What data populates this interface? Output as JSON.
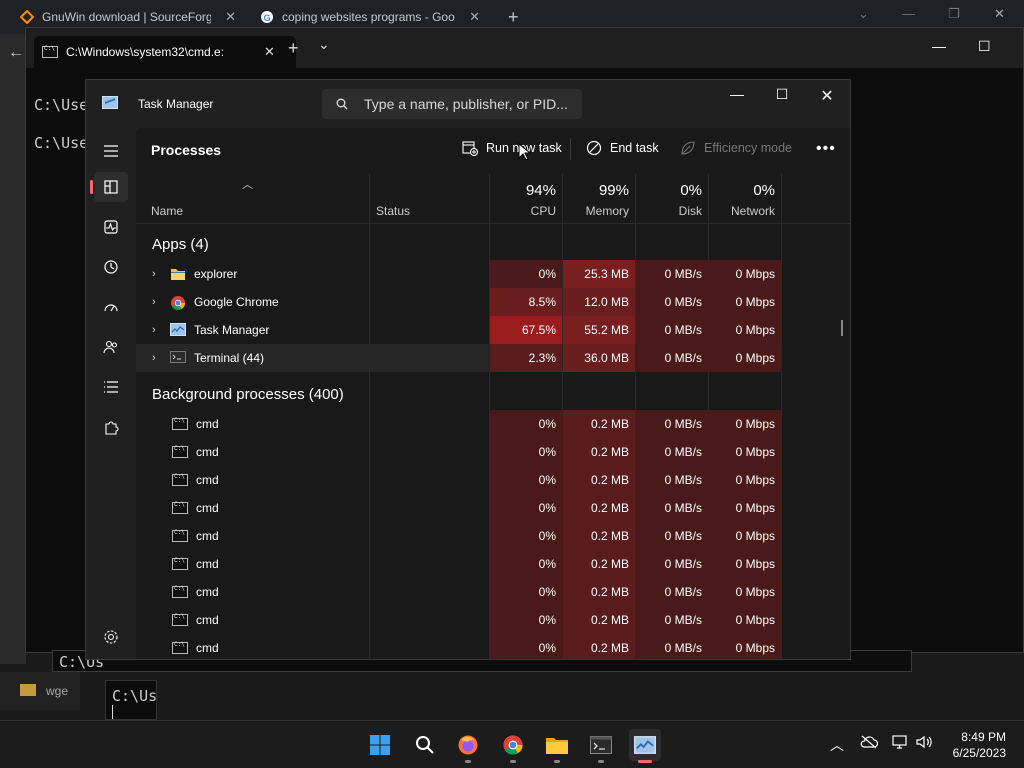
{
  "browser": {
    "tabs": [
      {
        "title": "GnuWin download | SourceForge",
        "close": "✕"
      },
      {
        "title": "coping websites programs - Goo",
        "close": "✕"
      }
    ],
    "new_tab": "+"
  },
  "terminal": {
    "tab_title": "C:\\Windows\\system32\\cmd.e:",
    "close": "✕",
    "new_tab": "+",
    "dropdown": "⌄",
    "prompt_lines": [
      "C:\\Use",
      "C:\\Use"
    ],
    "behind_lines": [
      "C:\\Us",
      "C:\\Us",
      "wge"
    ]
  },
  "task_manager": {
    "title": "Task Manager",
    "search_placeholder": "Type a name, publisher, or PID...",
    "page_title": "Processes",
    "toolbar": {
      "run_new_task": "Run new task",
      "end_task": "End task",
      "efficiency_mode": "Efficiency mode",
      "more": "•••"
    },
    "columns": {
      "name": "Name",
      "status": "Status",
      "cpu_pct": "94%",
      "cpu": "CPU",
      "mem_pct": "99%",
      "mem": "Memory",
      "disk_pct": "0%",
      "disk": "Disk",
      "net_pct": "0%",
      "net": "Network"
    },
    "groups": {
      "apps": "Apps (4)",
      "background": "Background processes (400)"
    },
    "apps": [
      {
        "name": "explorer",
        "icon": "folder-icon",
        "cpu": "0%",
        "mem": "25.3 MB",
        "disk": "0 MB/s",
        "net": "0 Mbps"
      },
      {
        "name": "Google Chrome",
        "icon": "chrome-icon",
        "cpu": "8.5%",
        "mem": "12.0 MB",
        "disk": "0 MB/s",
        "net": "0 Mbps"
      },
      {
        "name": "Task Manager",
        "icon": "task-manager-icon",
        "cpu": "67.5%",
        "mem": "55.2 MB",
        "disk": "0 MB/s",
        "net": "0 Mbps"
      },
      {
        "name": "Terminal (44)",
        "icon": "terminal-icon",
        "cpu": "2.3%",
        "mem": "36.0 MB",
        "disk": "0 MB/s",
        "net": "0 Mbps"
      }
    ],
    "background": [
      {
        "name": "cmd",
        "cpu": "0%",
        "mem": "0.2 MB",
        "disk": "0 MB/s",
        "net": "0 Mbps"
      },
      {
        "name": "cmd",
        "cpu": "0%",
        "mem": "0.2 MB",
        "disk": "0 MB/s",
        "net": "0 Mbps"
      },
      {
        "name": "cmd",
        "cpu": "0%",
        "mem": "0.2 MB",
        "disk": "0 MB/s",
        "net": "0 Mbps"
      },
      {
        "name": "cmd",
        "cpu": "0%",
        "mem": "0.2 MB",
        "disk": "0 MB/s",
        "net": "0 Mbps"
      },
      {
        "name": "cmd",
        "cpu": "0%",
        "mem": "0.2 MB",
        "disk": "0 MB/s",
        "net": "0 Mbps"
      },
      {
        "name": "cmd",
        "cpu": "0%",
        "mem": "0.2 MB",
        "disk": "0 MB/s",
        "net": "0 Mbps"
      },
      {
        "name": "cmd",
        "cpu": "0%",
        "mem": "0.2 MB",
        "disk": "0 MB/s",
        "net": "0 Mbps"
      },
      {
        "name": "cmd",
        "cpu": "0%",
        "mem": "0.2 MB",
        "disk": "0 MB/s",
        "net": "0 Mbps"
      },
      {
        "name": "cmd",
        "cpu": "0%",
        "mem": "0.2 MB",
        "disk": "0 MB/s",
        "net": "0 Mbps"
      }
    ],
    "colors": {
      "heat_low": "#4a1a1a",
      "heat_mid": "#6b1e1e",
      "heat_high": "#9b1c1c",
      "accent": "#ff6b6b"
    }
  },
  "taskbar": {
    "time": "8:49 PM",
    "date": "6/25/2023",
    "icons": [
      "windows-start-icon",
      "search-icon",
      "firefox-icon",
      "chrome-icon",
      "file-explorer-icon",
      "terminal-icon",
      "task-manager-icon"
    ]
  }
}
